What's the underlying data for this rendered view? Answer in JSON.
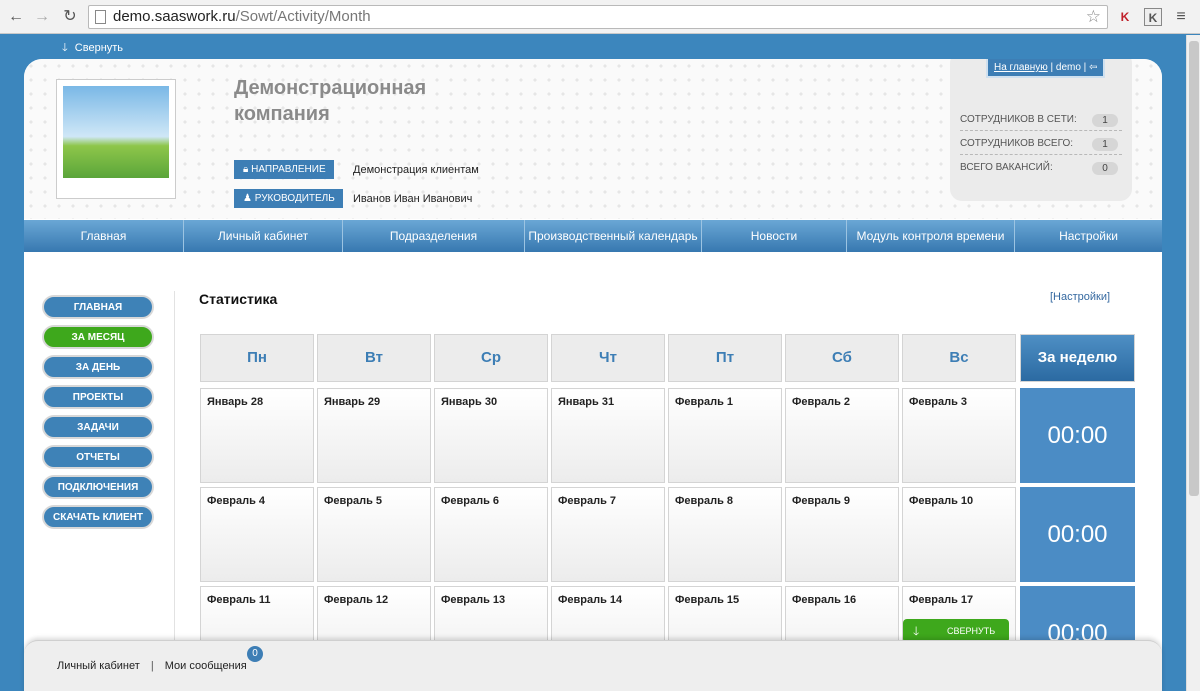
{
  "browser": {
    "url_host": "demo.saaswork.ru",
    "url_path": "/Sowt/Activity/Month"
  },
  "collapse_top_label": "Свернуть",
  "company": {
    "name": "Демонстрационная компания",
    "direction_label": "НАПРАВЛЕНИЕ",
    "direction_value": "Демонстрация клиентам",
    "manager_label": "РУКОВОДИТЕЛЬ",
    "manager_value": "Иванов Иван Иванович"
  },
  "user_links": {
    "home": "На главную",
    "user": "demo"
  },
  "stats": [
    {
      "label": "СОТРУДНИКОВ В СЕТИ:",
      "value": "1"
    },
    {
      "label": "СОТРУДНИКОВ ВСЕГО:",
      "value": "1"
    },
    {
      "label": "ВСЕГО ВАКАНСИЙ:",
      "value": "0"
    }
  ],
  "topnav": [
    "Главная",
    "Личный кабинет",
    "Подразделения",
    "Производственный календарь",
    "Новости",
    "Модуль контроля времени",
    "Настройки"
  ],
  "sidebar": [
    "ГЛАВНАЯ",
    "ЗА МЕСЯЦ",
    "ЗА ДЕНЬ",
    "ПРОЕКТЫ",
    "ЗАДАЧИ",
    "ОТЧЕТЫ",
    "ПОДКЛЮЧЕНИЯ",
    "СКАЧАТЬ КЛИЕНТ"
  ],
  "section_title": "Статистика",
  "settings_link": "[Настройки]",
  "calendar": {
    "headers": [
      "Пн",
      "Вт",
      "Ср",
      "Чт",
      "Пт",
      "Сб",
      "Вс"
    ],
    "week_header": "За неделю",
    "weeks": [
      {
        "days": [
          "Январь 28",
          "Январь 29",
          "Январь 30",
          "Январь 31",
          "Февраль 1",
          "Февраль 2",
          "Февраль 3"
        ],
        "total": "00:00"
      },
      {
        "days": [
          "Февраль 4",
          "Февраль 5",
          "Февраль 6",
          "Февраль 7",
          "Февраль 8",
          "Февраль 9",
          "Февраль 10"
        ],
        "total": "00:00"
      },
      {
        "days": [
          "Февраль 11",
          "Февраль 12",
          "Февраль 13",
          "Февраль 14",
          "Февраль 15",
          "Февраль 16",
          "Февраль 17"
        ],
        "total": "00:00"
      }
    ]
  },
  "collapse_bottom_label": "СВЕРНУТЬ",
  "bottombar": {
    "cabinet": "Личный кабинет",
    "messages": "Мои сообщения",
    "messages_count": "0"
  }
}
